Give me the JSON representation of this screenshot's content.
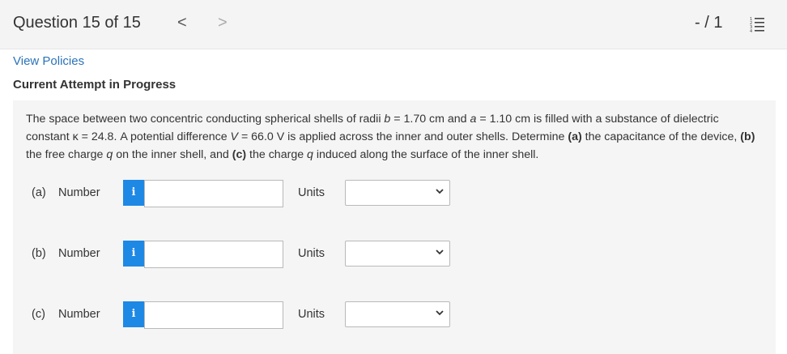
{
  "header": {
    "question_title": "Question 15 of 15",
    "prev_arrow": "<",
    "next_arrow": ">",
    "score": "- / 1",
    "list_icon": "question-list-icon"
  },
  "links": {
    "view_policies": "View Policies"
  },
  "status": {
    "attempt": "Current Attempt in Progress"
  },
  "question": {
    "text_1": "The space between two concentric conducting spherical shells of radii ",
    "var_b": "b",
    "text_2": " = 1.70 cm and ",
    "var_a": "a",
    "text_3": " = 1.10 cm is filled with a substance of dielectric constant κ = 24.8. A potential difference ",
    "var_V": "V",
    "text_4": " = 66.0 V is applied across the inner and outer shells. Determine ",
    "part_a_mark": "(a)",
    "text_5": " the capacitance of the device, ",
    "part_b_mark": "(b)",
    "text_6": " the free charge ",
    "var_q1": "q",
    "text_7": " on the inner shell, and ",
    "part_c_mark": "(c)",
    "text_8": " the charge ",
    "var_q2": "q",
    "text_9": " induced along the surface of the inner shell."
  },
  "parts": [
    {
      "label": "(a)",
      "number_label": "Number",
      "info": "i",
      "value": "",
      "units_label": "Units",
      "units_selected": ""
    },
    {
      "label": "(b)",
      "number_label": "Number",
      "info": "i",
      "value": "",
      "units_label": "Units",
      "units_selected": ""
    },
    {
      "label": "(c)",
      "number_label": "Number",
      "info": "i",
      "value": "",
      "units_label": "Units",
      "units_selected": ""
    }
  ],
  "colors": {
    "accent": "#1e88e5",
    "link": "#2a73b8",
    "panel": "#f5f5f5",
    "header": "#f4f4f4"
  }
}
